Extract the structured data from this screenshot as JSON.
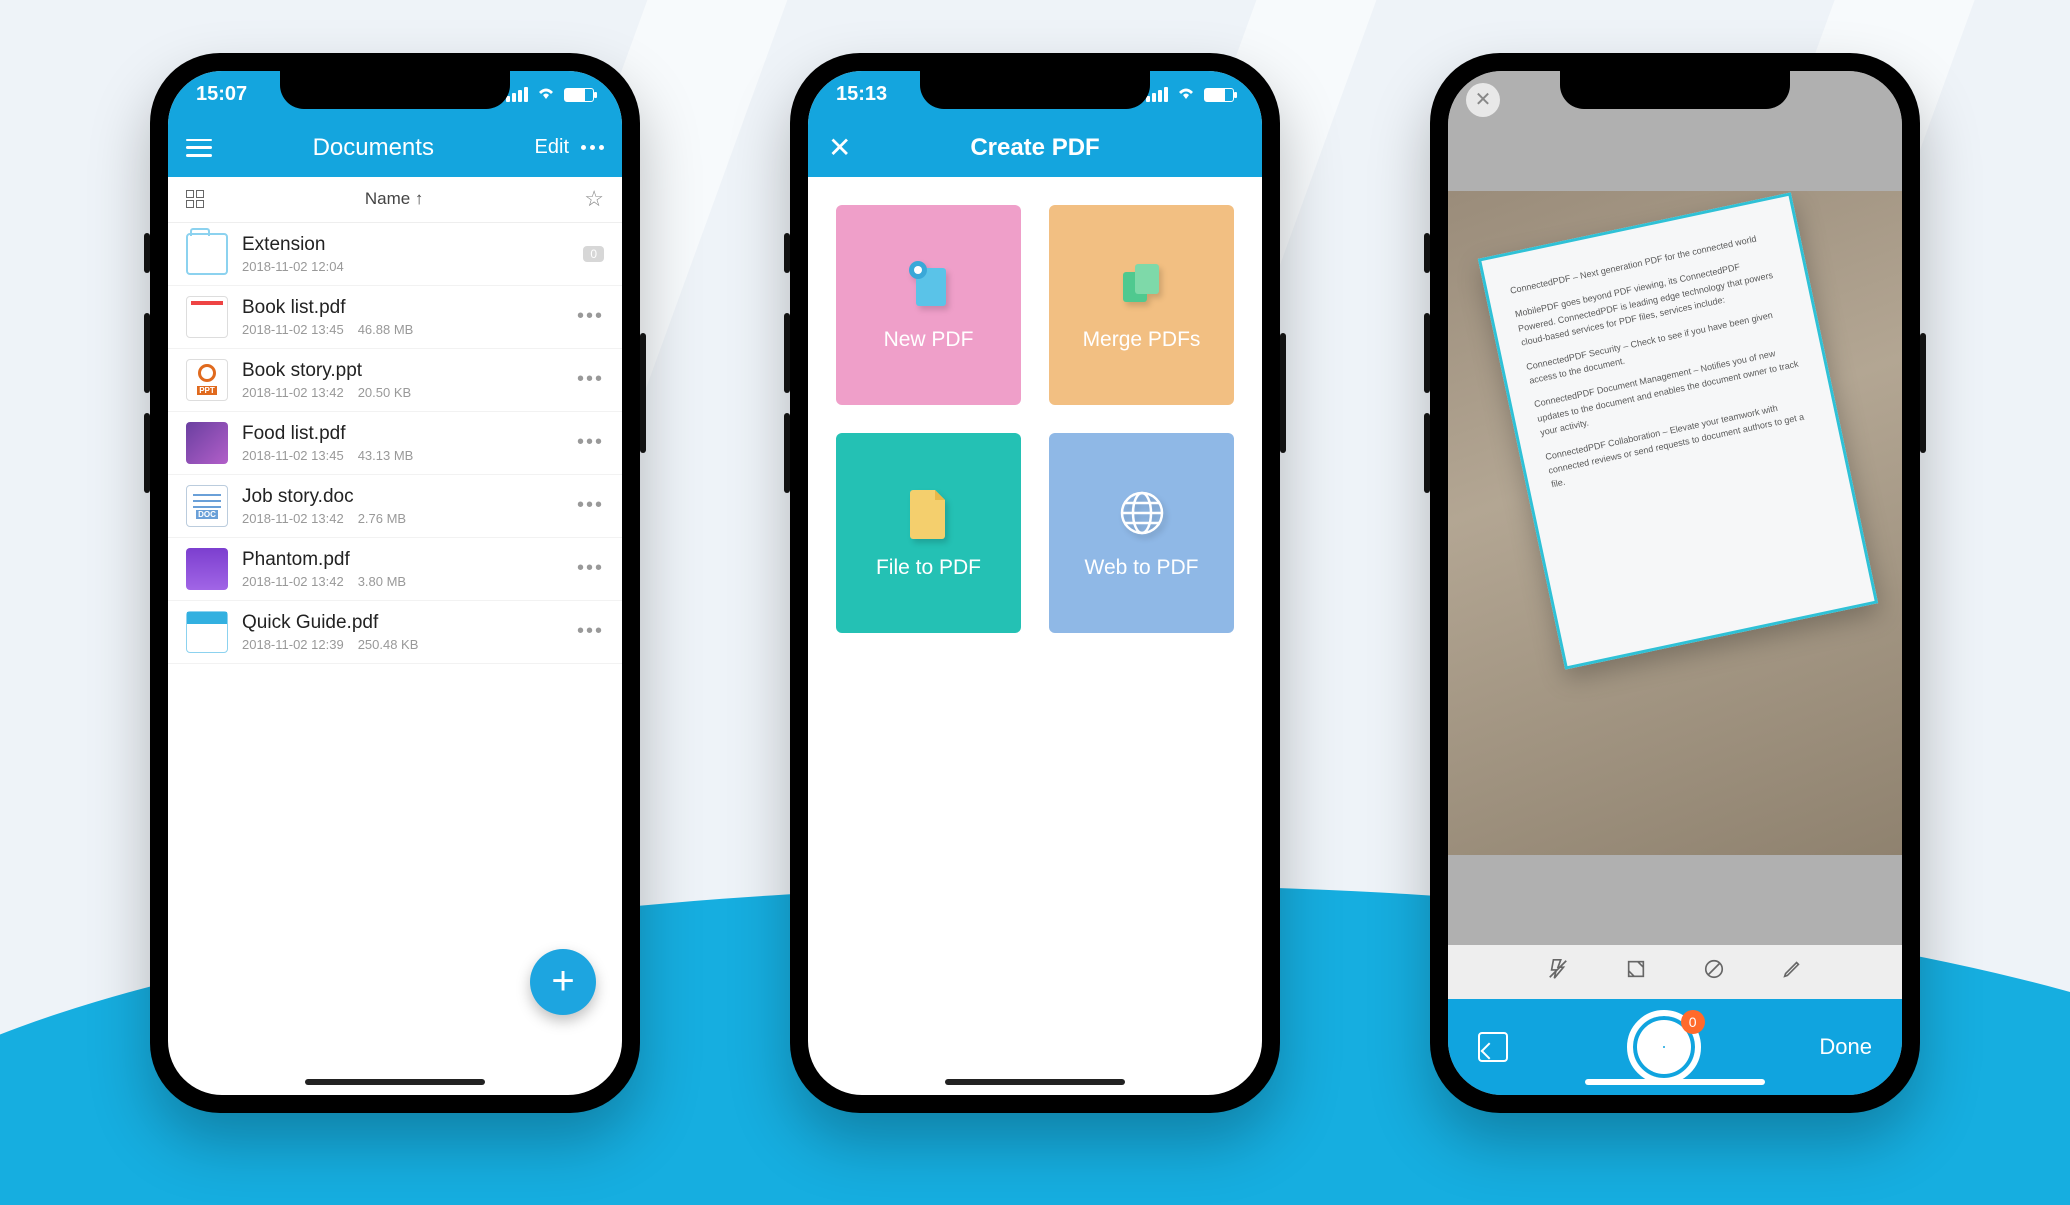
{
  "screen1": {
    "status_time": "15:07",
    "header_title": "Documents",
    "edit_label": "Edit",
    "sort_label": "Name ↑",
    "folder_badge": "0",
    "fab_label": "+",
    "files": [
      {
        "name": "Extension",
        "date": "2018-11-02 12:04",
        "size": "",
        "type": "folder"
      },
      {
        "name": "Book list.pdf",
        "date": "2018-11-02 13:45",
        "size": "46.88 MB",
        "type": "pdf"
      },
      {
        "name": "Book story.ppt",
        "date": "2018-11-02 13:42",
        "size": "20.50 KB",
        "type": "ppt"
      },
      {
        "name": "Food list.pdf",
        "date": "2018-11-02 13:45",
        "size": "43.13 MB",
        "type": "img"
      },
      {
        "name": "Job story.doc",
        "date": "2018-11-02 13:42",
        "size": "2.76 MB",
        "type": "doc"
      },
      {
        "name": "Phantom.pdf",
        "date": "2018-11-02 13:42",
        "size": "3.80 MB",
        "type": "card"
      },
      {
        "name": "Quick Guide.pdf",
        "date": "2018-11-02 12:39",
        "size": "250.48 KB",
        "type": "guide"
      }
    ]
  },
  "screen2": {
    "status_time": "15:13",
    "header_title": "Create PDF",
    "tiles": {
      "new": "New PDF",
      "merge": "Merge PDFs",
      "file": "File to PDF",
      "web": "Web to PDF"
    }
  },
  "screen3": {
    "done_label": "Done",
    "shutter_badge": "0",
    "paper_lines": [
      "ConnectedPDF – Next generation PDF for the connected world",
      "MobilePDF goes beyond PDF viewing, its ConnectedPDF Powered. ConnectedPDF is leading edge technology that powers cloud-based services for PDF files, services include:",
      "ConnectedPDF Security – Check to see if you have been given access to the document.",
      "ConnectedPDF Document Management – Notifies you of new updates to the document and enables the document owner to track your activity.",
      "ConnectedPDF Collaboration – Elevate your teamwork with connected reviews or send requests to document authors to get a file."
    ]
  }
}
